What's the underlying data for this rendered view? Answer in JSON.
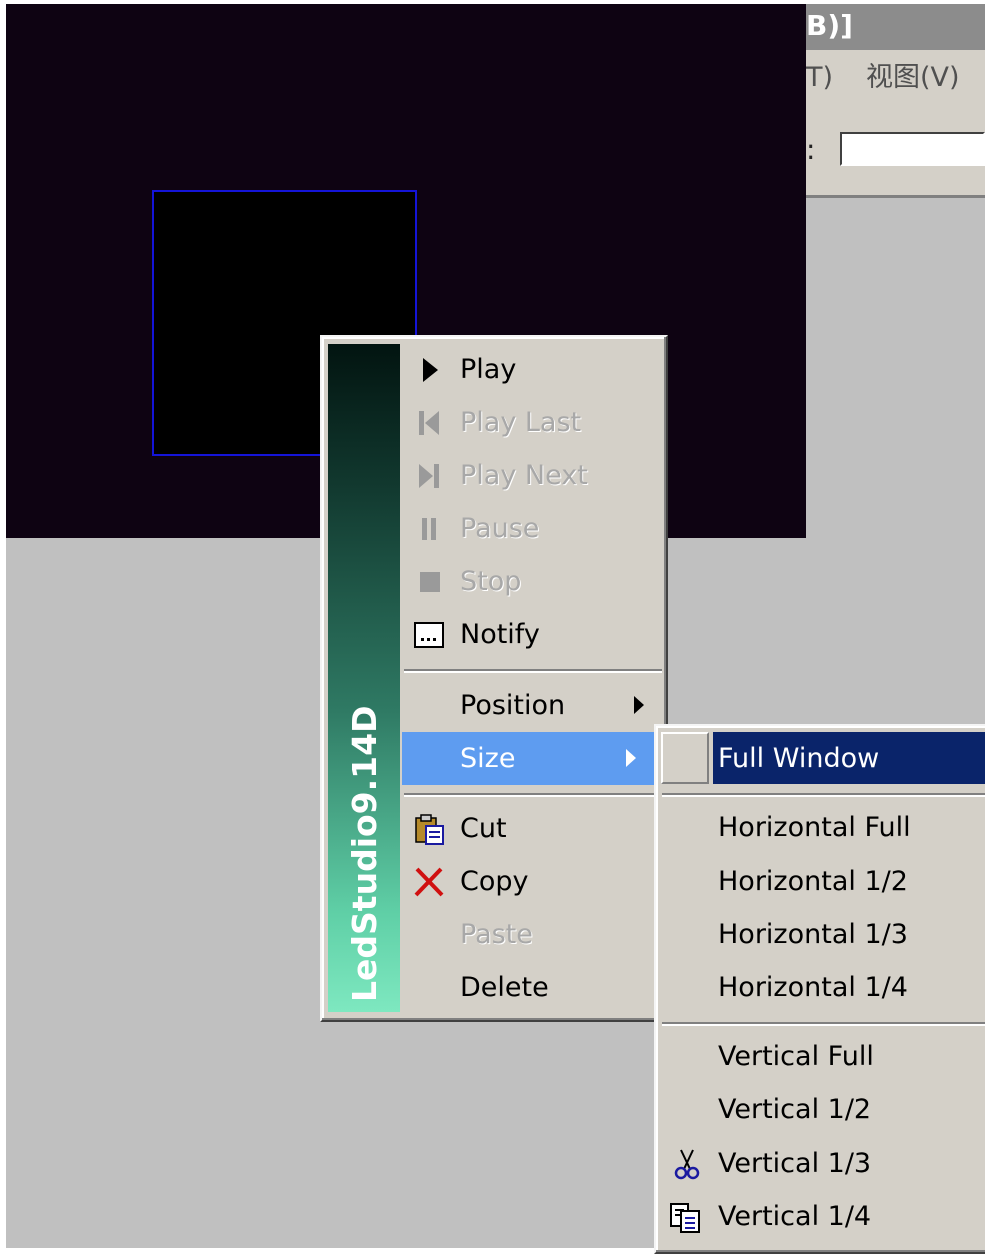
{
  "window": {
    "title_fragment": "B)]",
    "menubar": [
      "T)",
      "视图(V)"
    ],
    "toolbar_colon": ":"
  },
  "context_menu": {
    "banner": "LedStudio9.14D",
    "items": [
      {
        "label": "Play",
        "icon": "play-icon",
        "enabled": true
      },
      {
        "label": "Play Last",
        "icon": "skip-back-icon",
        "enabled": false
      },
      {
        "label": "Play Next",
        "icon": "skip-forward-icon",
        "enabled": false
      },
      {
        "label": "Pause",
        "icon": "pause-icon",
        "enabled": false
      },
      {
        "label": "Stop",
        "icon": "stop-icon",
        "enabled": false
      },
      {
        "label": "Notify",
        "icon": "notify-icon",
        "enabled": true
      },
      {
        "label": "Position",
        "submenu": true,
        "enabled": true
      },
      {
        "label": "Size",
        "submenu": true,
        "enabled": true,
        "selected": true
      },
      {
        "label": "Cut",
        "icon": "clipboard-icon",
        "enabled": true
      },
      {
        "label": "Copy",
        "icon": "delete-x-icon",
        "enabled": true
      },
      {
        "label": "Paste",
        "enabled": false
      },
      {
        "label": "Delete",
        "enabled": true
      }
    ]
  },
  "size_submenu": {
    "items": [
      {
        "label": "Full Window",
        "checked": true,
        "highlighted": true
      },
      {
        "label": "Horizontal Full"
      },
      {
        "label": "Horizontal 1/2"
      },
      {
        "label": "Horizontal 1/3"
      },
      {
        "label": "Horizontal 1/4"
      },
      {
        "label": "Vertical Full"
      },
      {
        "label": "Vertical 1/2"
      },
      {
        "label": "Vertical 1/3",
        "icon": "scissors-icon"
      },
      {
        "label": "Vertical 1/4",
        "icon": "paste-icon"
      }
    ]
  },
  "colors": {
    "canvas": "#0e0312",
    "selection_border": "#1414d8",
    "menu_bg": "#d4d0c8",
    "selected_item": "#5e9cf0",
    "submenu_highlight": "#0a246a"
  }
}
